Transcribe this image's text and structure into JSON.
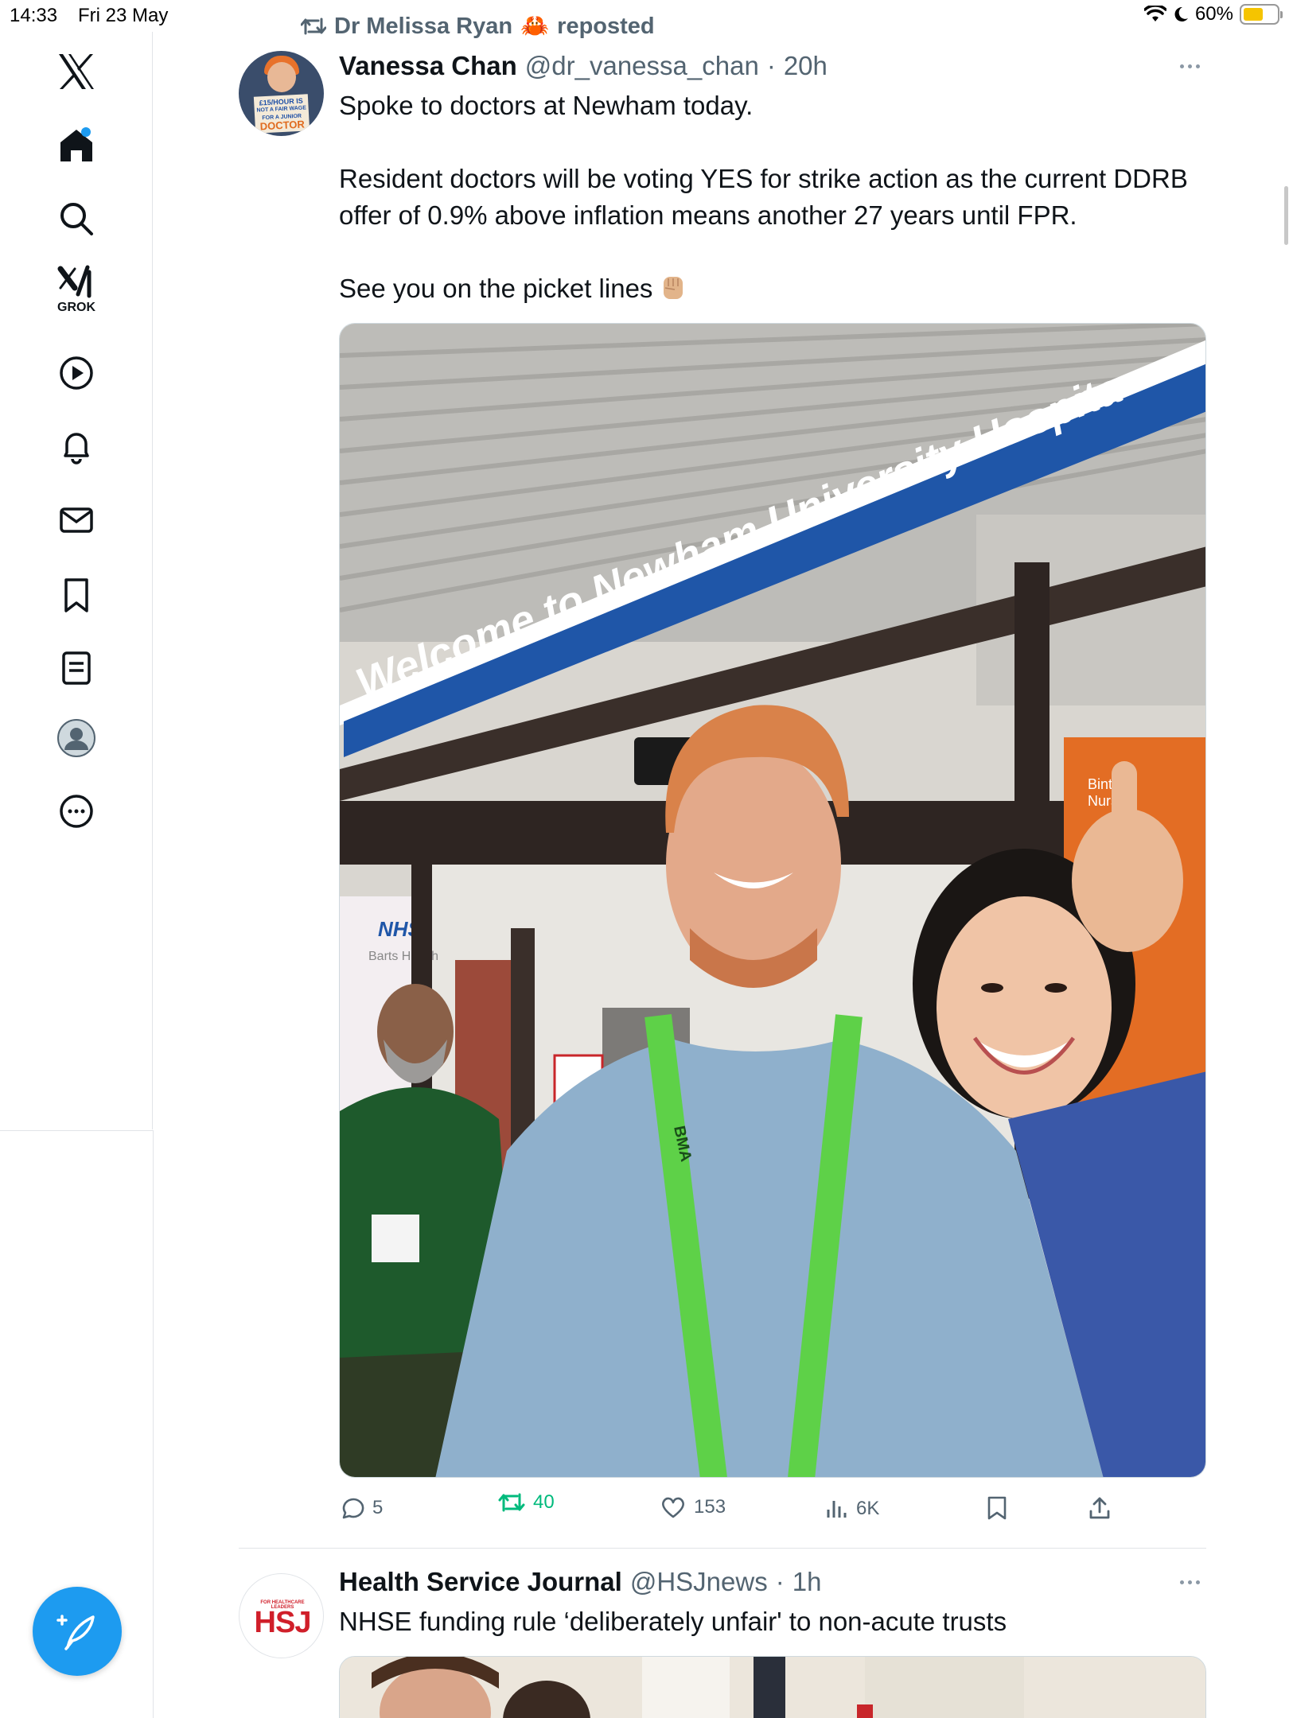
{
  "status_bar": {
    "time": "14:33",
    "date": "Fri 23 May",
    "battery_text": "60%",
    "battery_level": 0.6
  },
  "sidebar": {
    "items": [
      {
        "name": "x-logo",
        "label": ""
      },
      {
        "name": "home",
        "label": ""
      },
      {
        "name": "search",
        "label": ""
      },
      {
        "name": "grok",
        "label": "GROK"
      },
      {
        "name": "video",
        "label": ""
      },
      {
        "name": "notifications",
        "label": ""
      },
      {
        "name": "messages",
        "label": ""
      },
      {
        "name": "bookmarks",
        "label": ""
      },
      {
        "name": "lists",
        "label": ""
      },
      {
        "name": "profile",
        "label": ""
      },
      {
        "name": "more",
        "label": ""
      }
    ]
  },
  "tweet": {
    "repost_by": "Dr Melissa Ryan",
    "repost_emoji": "🦀",
    "repost_label": "reposted",
    "author_name": "Vanessa Chan",
    "author_handle": "@dr_vanessa_chan",
    "time": "20h",
    "avatar_sign": {
      "line1": "£15/HOUR IS",
      "line2": "NOT A FAIR WAGE",
      "line3": "FOR A JUNIOR",
      "line4": "DOCTOR"
    },
    "paragraphs": [
      "Spoke to doctors at Newham today.",
      "Resident doctors will be voting YES for strike action as the current DDRB offer of 0.9% above inflation means another 27 years until FPR.",
      "See you on the picket lines"
    ],
    "photo": {
      "sign_text": "Welcome to Newham University Hospita",
      "nhs_label": "NHS",
      "barts_label": "Barts Health",
      "poster_text1": "Bintu",
      "poster_text2": "Nurse",
      "lanyard_text": "BMA"
    },
    "metrics": {
      "replies": "5",
      "reposts": "40",
      "likes": "153",
      "views": "6K"
    }
  },
  "tweet2": {
    "author_name": "Health Service Journal",
    "author_handle": "@HSJnews",
    "time": "1h",
    "text": "NHSE funding rule ‘deliberately unfair' to non-acute trusts",
    "avatar_tag": "FOR HEALTHCARE LEADERS",
    "avatar_logo": "HSJ"
  },
  "colors": {
    "accent": "#1d9bf0",
    "repost_green": "#00ba7c",
    "muted": "#536471",
    "sign_blue": "#1f56a8"
  }
}
